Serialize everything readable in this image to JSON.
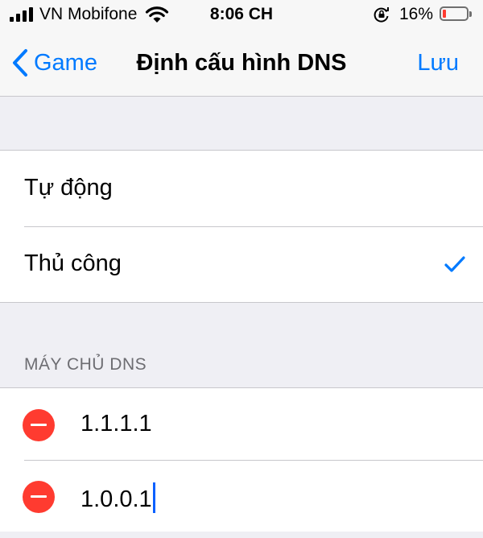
{
  "status_bar": {
    "carrier": "VN Mobifone",
    "time": "8:06 CH",
    "battery": "16%",
    "battery_level": 0.16,
    "battery_color": "#ff3b30"
  },
  "nav": {
    "back_label": "Game",
    "title": "Định cấu hình DNS",
    "save_label": "Lưu"
  },
  "mode": {
    "options": [
      {
        "label": "Tự động",
        "selected": false
      },
      {
        "label": "Thủ công",
        "selected": true
      }
    ]
  },
  "dns": {
    "header": "MÁY CHỦ DNS",
    "servers": [
      "1.1.1.1",
      "1.0.0.1"
    ]
  },
  "colors": {
    "accent": "#007aff",
    "destructive": "#ff3b30",
    "background": "#efeff4"
  },
  "icons": [
    "signal-icon",
    "wifi-icon",
    "rotation-lock-icon",
    "battery-icon",
    "chevron-left-icon",
    "checkmark-icon",
    "remove-icon"
  ]
}
